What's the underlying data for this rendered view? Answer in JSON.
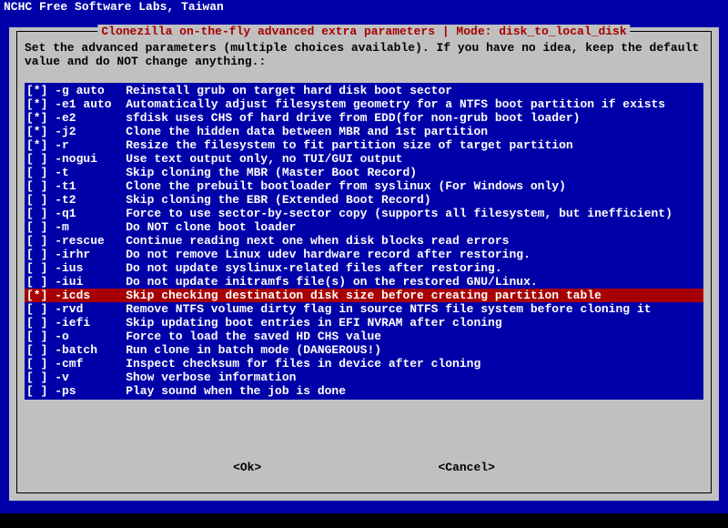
{
  "header": "NCHC Free Software Labs, Taiwan",
  "frame_title": " Clonezilla on-the-fly advanced extra parameters | Mode: disk_to_local_disk ",
  "instruction": "Set the advanced parameters (multiple choices available). If you have no idea, keep the default value and do NOT change anything.:",
  "items": [
    {
      "checked": true,
      "selected": false,
      "flag": "-g auto",
      "desc": "Reinstall grub on target hard disk boot sector"
    },
    {
      "checked": true,
      "selected": false,
      "flag": "-e1 auto",
      "desc": "Automatically adjust filesystem geometry for a NTFS boot partition if exists"
    },
    {
      "checked": true,
      "selected": false,
      "flag": "-e2",
      "desc": "sfdisk uses CHS of hard drive from EDD(for non-grub boot loader)"
    },
    {
      "checked": true,
      "selected": false,
      "flag": "-j2",
      "desc": "Clone the hidden data between MBR and 1st partition"
    },
    {
      "checked": true,
      "selected": false,
      "flag": "-r",
      "desc": "Resize the filesystem to fit partition size of target partition"
    },
    {
      "checked": false,
      "selected": false,
      "flag": "-nogui",
      "desc": "Use text output only, no TUI/GUI output"
    },
    {
      "checked": false,
      "selected": false,
      "flag": "-t",
      "desc": "Skip cloning the MBR (Master Boot Record)"
    },
    {
      "checked": false,
      "selected": false,
      "flag": "-t1",
      "desc": "Clone the prebuilt bootloader from syslinux (For Windows only)"
    },
    {
      "checked": false,
      "selected": false,
      "flag": "-t2",
      "desc": "Skip cloning the EBR (Extended Boot Record)"
    },
    {
      "checked": false,
      "selected": false,
      "flag": "-q1",
      "desc": "Force to use sector-by-sector copy (supports all filesystem, but inefficient)"
    },
    {
      "checked": false,
      "selected": false,
      "flag": "-m",
      "desc": "Do NOT clone boot loader"
    },
    {
      "checked": false,
      "selected": false,
      "flag": "-rescue",
      "desc": "Continue reading next one when disk blocks read errors"
    },
    {
      "checked": false,
      "selected": false,
      "flag": "-irhr",
      "desc": "Do not remove Linux udev hardware record after restoring."
    },
    {
      "checked": false,
      "selected": false,
      "flag": "-ius",
      "desc": "Do not update syslinux-related files after restoring."
    },
    {
      "checked": false,
      "selected": false,
      "flag": "-iui",
      "desc": "Do not update initramfs file(s) on the restored GNU/Linux."
    },
    {
      "checked": true,
      "selected": true,
      "flag": "-icds",
      "desc": "Skip checking destination disk size before creating partition table"
    },
    {
      "checked": false,
      "selected": false,
      "flag": "-rvd",
      "desc": "Remove NTFS volume dirty flag in source NTFS file system before cloning it"
    },
    {
      "checked": false,
      "selected": false,
      "flag": "-iefi",
      "desc": "Skip updating boot entries in EFI NVRAM after cloning"
    },
    {
      "checked": false,
      "selected": false,
      "flag": "-o",
      "desc": "Force to load the saved HD CHS value"
    },
    {
      "checked": false,
      "selected": false,
      "flag": "-batch",
      "desc": "Run clone in batch mode (DANGEROUS!)"
    },
    {
      "checked": false,
      "selected": false,
      "flag": "-cmf",
      "desc": "Inspect checksum for files in device after cloning"
    },
    {
      "checked": false,
      "selected": false,
      "flag": "-v",
      "desc": "Show verbose information"
    },
    {
      "checked": false,
      "selected": false,
      "flag": "-ps",
      "desc": "Play sound when the job is done"
    }
  ],
  "buttons": {
    "ok": "<Ok>",
    "cancel": "<Cancel>"
  }
}
